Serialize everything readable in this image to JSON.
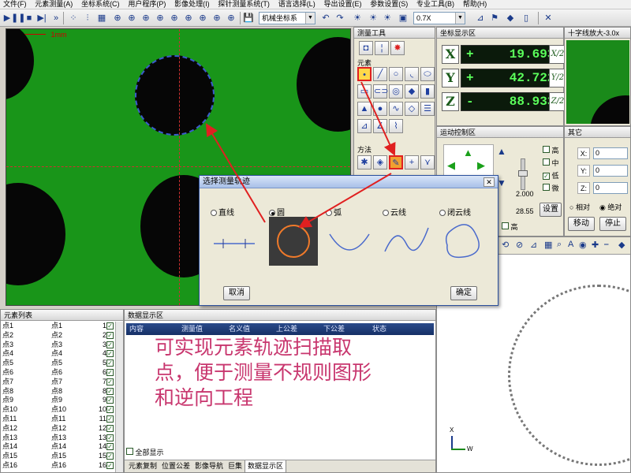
{
  "menu": [
    "文件(F)",
    "元素测量(A)",
    "坐标系统(C)",
    "用户程序(P)",
    "影像处理(I)",
    "探针测量系统(T)",
    "语言选择(L)",
    "导出设置(E)",
    "参数设置(S)",
    "专业工具(B)",
    "帮助(H)"
  ],
  "toolbar": {
    "coord_system": "机械坐标系",
    "zoom": "0.7X"
  },
  "camera": {
    "scale_label": "1mm"
  },
  "measure_tools": {
    "title": "测量工具",
    "elements_label": "元素",
    "method_label": "方法"
  },
  "coord_panel": {
    "title": "坐标显示区",
    "rows": [
      {
        "axis": "X",
        "sign": "+",
        "value": "19.6935",
        "half": "X/2"
      },
      {
        "axis": "Y",
        "sign": "+",
        "value": "42.7220",
        "half": "Y/2"
      },
      {
        "axis": "Z",
        "sign": "-",
        "value": "88.9335",
        "half": "Z/2"
      }
    ]
  },
  "preview": {
    "title": "十字线放大-3.0x"
  },
  "motion": {
    "title": "运动控制区",
    "speed_options": [
      "高",
      "中",
      "低",
      "微"
    ],
    "speed_checked": "低",
    "value1": "2.000",
    "value2": "28.55",
    "setup_label": "设置",
    "high_label": "高"
  },
  "other": {
    "title": "其它",
    "fields": [
      {
        "label": "X:",
        "value": "0"
      },
      {
        "label": "Y:",
        "value": "0"
      },
      {
        "label": "Z:",
        "value": "0"
      }
    ],
    "relative": "相对",
    "absolute": "绝对",
    "move": "移动",
    "stop": "停止"
  },
  "dialog": {
    "title": "选择测量轨迹",
    "options": [
      "直线",
      "圆",
      "弧",
      "云线",
      "闭云线"
    ],
    "selected": "圆",
    "cancel": "取消",
    "ok": "确定"
  },
  "list": {
    "title": "元素列表",
    "rows": [
      {
        "name": "点1",
        "type": "点1",
        "num": "1"
      },
      {
        "name": "点2",
        "type": "点2",
        "num": "2"
      },
      {
        "name": "点3",
        "type": "点3",
        "num": "3"
      },
      {
        "name": "点4",
        "type": "点4",
        "num": "4"
      },
      {
        "name": "点5",
        "type": "点5",
        "num": "5"
      },
      {
        "name": "点6",
        "type": "点6",
        "num": "6"
      },
      {
        "name": "点7",
        "type": "点7",
        "num": "7"
      },
      {
        "name": "点8",
        "type": "点8",
        "num": "8"
      },
      {
        "name": "点9",
        "type": "点9",
        "num": "9"
      },
      {
        "name": "点10",
        "type": "点10",
        "num": "10"
      },
      {
        "name": "点11",
        "type": "点11",
        "num": "11"
      },
      {
        "name": "点12",
        "type": "点12",
        "num": "12"
      },
      {
        "name": "点13",
        "type": "点13",
        "num": "13"
      },
      {
        "name": "点14",
        "type": "点14",
        "num": "14"
      },
      {
        "name": "点15",
        "type": "点15",
        "num": "15"
      },
      {
        "name": "点16",
        "type": "点16",
        "num": "16"
      }
    ]
  },
  "data_panel": {
    "title": "数据显示区",
    "headers": [
      "内容",
      "测量值",
      "名义值",
      "上公差",
      "下公差",
      "状态"
    ],
    "annotation_lines": [
      "可实现元素轨迹扫描取",
      "点，便于测量不规则图形",
      "和逆向工程"
    ],
    "show_all": "全部显示",
    "tabs": [
      "元素复制",
      "位置公差",
      "影像导航",
      "巨集",
      "数据显示区"
    ]
  },
  "axis_view": {
    "y_label": "X",
    "x_label": "W"
  },
  "colors": {
    "camera_green": "#199519",
    "annotation": "#c8366e",
    "readout_text": "#5bff5b",
    "arrow": "#e02020"
  }
}
